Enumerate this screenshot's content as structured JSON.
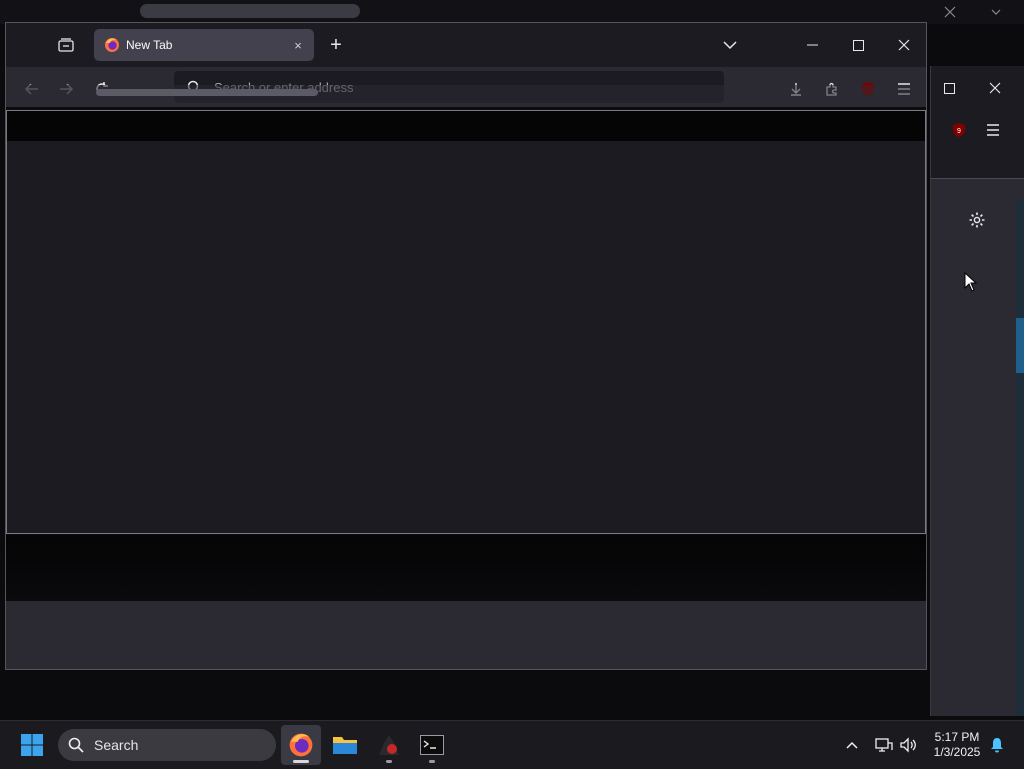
{
  "window": {
    "tab": {
      "title": "New Tab",
      "close_label": "×"
    },
    "new_tab_label": "+",
    "url_placeholder": "Search or enter address"
  },
  "taskbar": {
    "search_label": "Search",
    "time": "5:17 PM",
    "date": "1/3/2025"
  },
  "colors": {
    "toolbar": "#2b2a33",
    "tabbar": "#1c1b22",
    "active_tab": "#42414d",
    "taskbar": "#1b1b1f"
  },
  "icons": [
    "tab-list-icon",
    "firefox-icon",
    "close-icon",
    "plus-icon",
    "chevron-down-icon",
    "minimize-icon",
    "maximize-icon",
    "back-icon",
    "forward-icon",
    "reload-icon",
    "search-icon",
    "download-icon",
    "extensions-icon",
    "ublock-icon",
    "menu-icon",
    "settings-gear-icon",
    "windows-start-icon",
    "file-explorer-icon",
    "terminal-icon",
    "wifi-icon",
    "volume-icon",
    "notification-bell-icon",
    "chevron-up-icon"
  ]
}
